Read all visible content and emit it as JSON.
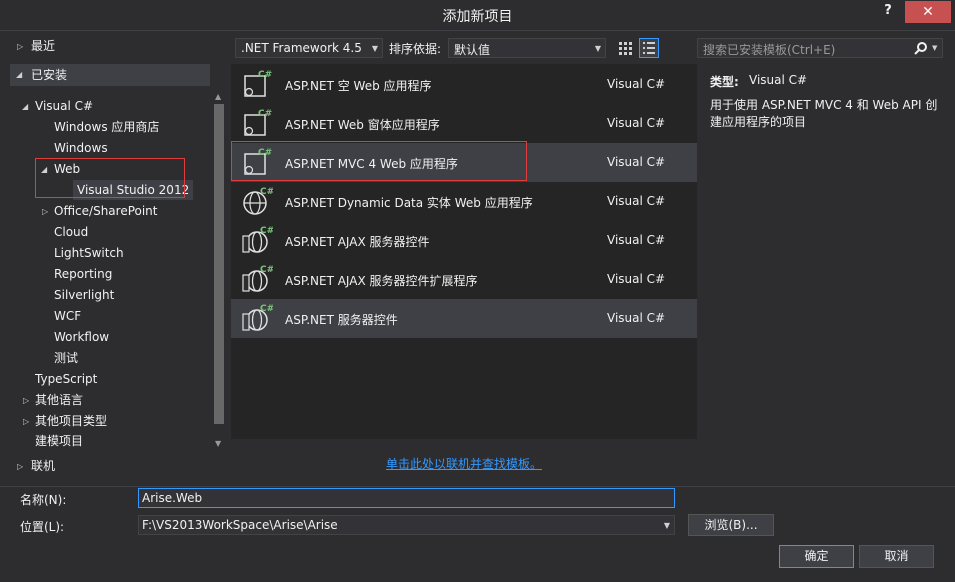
{
  "window": {
    "title": "添加新项目",
    "help": "?",
    "close": "✕"
  },
  "tree": {
    "recent": "最近",
    "installed": "已安装",
    "visual_csharp": "Visual C#",
    "windows_store": "Windows 应用商店",
    "windows": "Windows",
    "web": "Web",
    "vs2012": "Visual Studio 2012",
    "office_sharepoint": "Office/SharePoint",
    "cloud": "Cloud",
    "lightswitch": "LightSwitch",
    "reporting": "Reporting",
    "silverlight": "Silverlight",
    "wcf": "WCF",
    "workflow": "Workflow",
    "test": "测试",
    "typescript": "TypeScript",
    "other_languages": "其他语言",
    "other_project_types": "其他项目类型",
    "modeling_projects": "建模项目",
    "online": "联机"
  },
  "toolbar": {
    "framework": ".NET Framework 4.5",
    "sort_label": "排序依据:",
    "sort_value": "默认值",
    "search_placeholder": "搜索已安装模板(Ctrl+E)"
  },
  "templates": [
    {
      "name": "ASP.NET 空 Web 应用程序",
      "lang": "Visual C#",
      "icon": "web-app-icon"
    },
    {
      "name": "ASP.NET Web 窗体应用程序",
      "lang": "Visual C#",
      "icon": "web-app-icon"
    },
    {
      "name": "ASP.NET MVC 4 Web 应用程序",
      "lang": "Visual C#",
      "icon": "web-app-icon"
    },
    {
      "name": "ASP.NET Dynamic Data 实体 Web 应用程序",
      "lang": "Visual C#",
      "icon": "globe-icon"
    },
    {
      "name": "ASP.NET AJAX 服务器控件",
      "lang": "Visual C#",
      "icon": "globe-server-icon"
    },
    {
      "name": "ASP.NET AJAX 服务器控件扩展程序",
      "lang": "Visual C#",
      "icon": "globe-server-icon"
    },
    {
      "name": "ASP.NET 服务器控件",
      "lang": "Visual C#",
      "icon": "globe-server-icon"
    }
  ],
  "online_link": "单击此处以联机并查找模板。",
  "description": {
    "type_label": "类型:",
    "type_value": "Visual C#",
    "text": "用于使用 ASP.NET MVC 4 和 Web API 创建应用程序的项目"
  },
  "form": {
    "name_label": "名称(N):",
    "name_value": "Arise.Web",
    "location_label": "位置(L):",
    "location_value": "F:\\VS2013WorkSpace\\Arise\\Arise",
    "browse": "浏览(B)...",
    "ok": "确定",
    "cancel": "取消"
  },
  "colors": {
    "accent": "#3399ff",
    "highlight_box": "#e03c3c",
    "background": "#2d2d30"
  }
}
